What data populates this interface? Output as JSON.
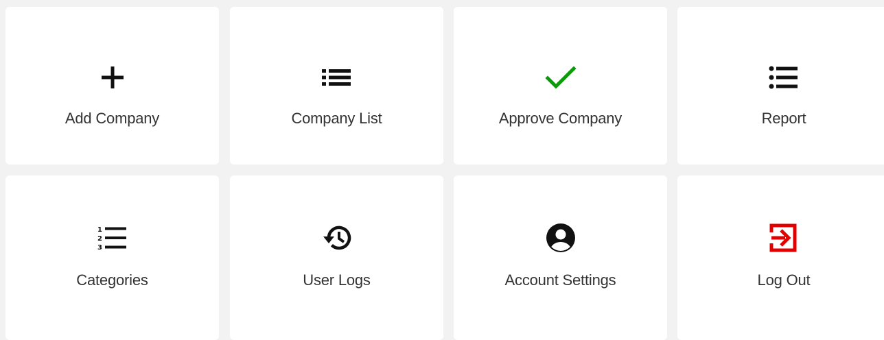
{
  "tiles": [
    {
      "label": "Add Company",
      "icon": "plus-icon"
    },
    {
      "label": "Company List",
      "icon": "list-icon"
    },
    {
      "label": "Approve Company",
      "icon": "check-icon"
    },
    {
      "label": "Report",
      "icon": "list-bullet-icon"
    },
    {
      "label": "Categories",
      "icon": "numbered-list-icon"
    },
    {
      "label": "User Logs",
      "icon": "history-icon"
    },
    {
      "label": "Account Settings",
      "icon": "account-circle-icon"
    },
    {
      "label": "Log Out",
      "icon": "logout-icon"
    }
  ],
  "colors": {
    "check": "#0a9a0a",
    "logout": "#e00000",
    "icon_default": "#111111",
    "tile_bg": "#ffffff",
    "page_bg": "#f2f2f2"
  }
}
